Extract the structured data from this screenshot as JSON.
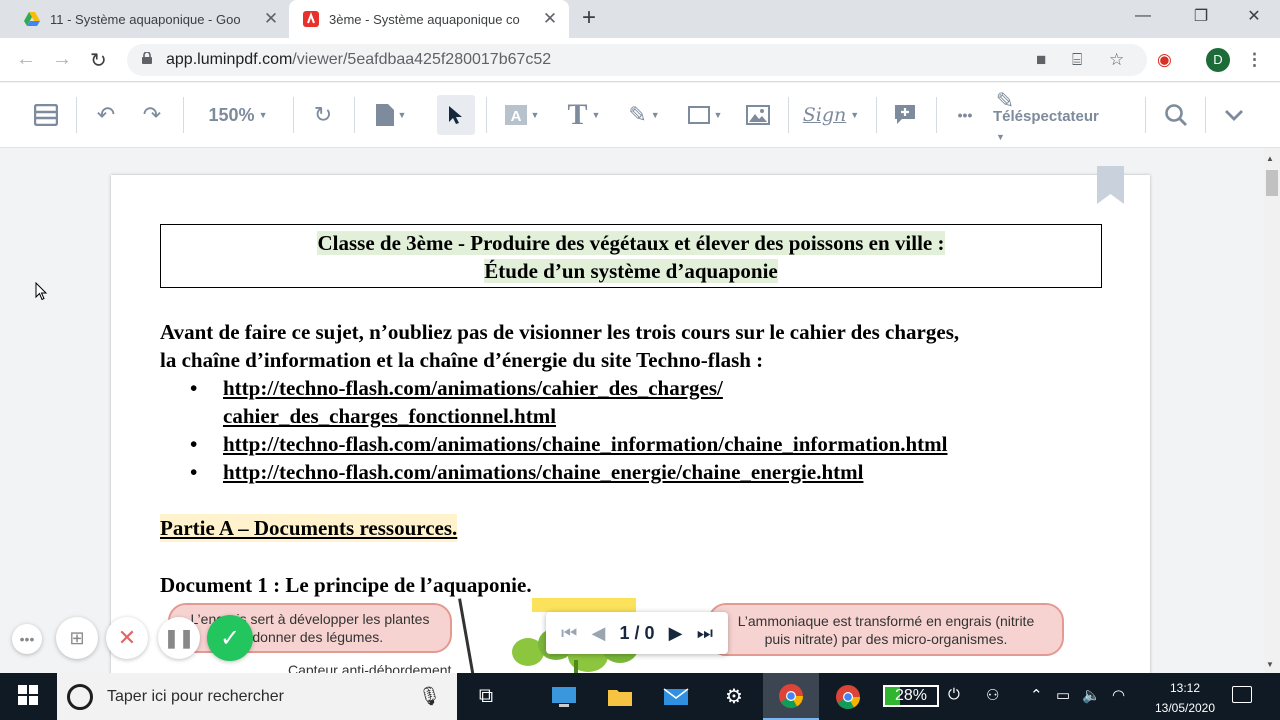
{
  "tabs": [
    {
      "title": "11 - Système aquaponique - Goo",
      "close": "✕",
      "icon": "google-drive-icon"
    },
    {
      "title": "3ème - Système aquaponique co",
      "close": "✕",
      "icon": "lumin-pdf-icon"
    }
  ],
  "new_tab": "+",
  "window_controls": {
    "minimize": "—",
    "maximize": "❐",
    "close": "✕"
  },
  "address": {
    "host": "app.luminpdf.com",
    "path": "/viewer/5eafdbaa425f280017b67c52"
  },
  "profile_initial": "D",
  "toolbar": {
    "zoom": "150%",
    "sign_label": "Sign",
    "more": "•••",
    "viewer_mode": "Téléspectateur"
  },
  "document": {
    "title_line1": "Classe de 3ème - Produire des végétaux et élever des poissons en ville :",
    "title_line2": "Étude d’un système d’aquaponie",
    "intro_line1": "Avant de faire ce sujet, n’oubliez pas de visionner les trois cours sur le cahier des charges,",
    "intro_line2": "la chaîne d’information et la chaîne d’énergie du site Techno-flash :",
    "bullet": "•",
    "links": [
      {
        "line1": "http://techno-flash.com/animations/cahier_des_charges/",
        "line2": "cahier_des_charges_fonctionnel.html"
      },
      {
        "line1": "http://techno-flash.com/animations/chaine_information/chaine_information.html",
        "line2": ""
      },
      {
        "line1": "http://techno-flash.com/animations/chaine_energie/chaine_energie.html",
        "line2": ""
      }
    ],
    "part_a": "Partie A – Documents ressources.",
    "doc1_heading": "Document 1 : Le principe de l’aquaponie.",
    "bubble_left_line1": "L’engrais sert à développer les plantes",
    "bubble_left_line2": "et donner des légumes.",
    "bubble_right_line1": "L’ammoniaque est transformé en engrais (nitrite",
    "bubble_right_line2": "puis nitrate) par des micro-organismes.",
    "sensor_label": "Capteur anti-débordement"
  },
  "pager": {
    "text": "1 / 0"
  },
  "taskbar": {
    "search_placeholder": "Taper ici pour rechercher",
    "battery": "28%",
    "battery_level": 0.28,
    "time": "13:12",
    "date": "13/05/2020"
  },
  "colors": {
    "title_highlight": "#e2efd9",
    "part_highlight": "#fff2cc",
    "bubble_fill": "#f6d3d0",
    "check_green": "#22c55e",
    "taskbar": "#101a24"
  }
}
